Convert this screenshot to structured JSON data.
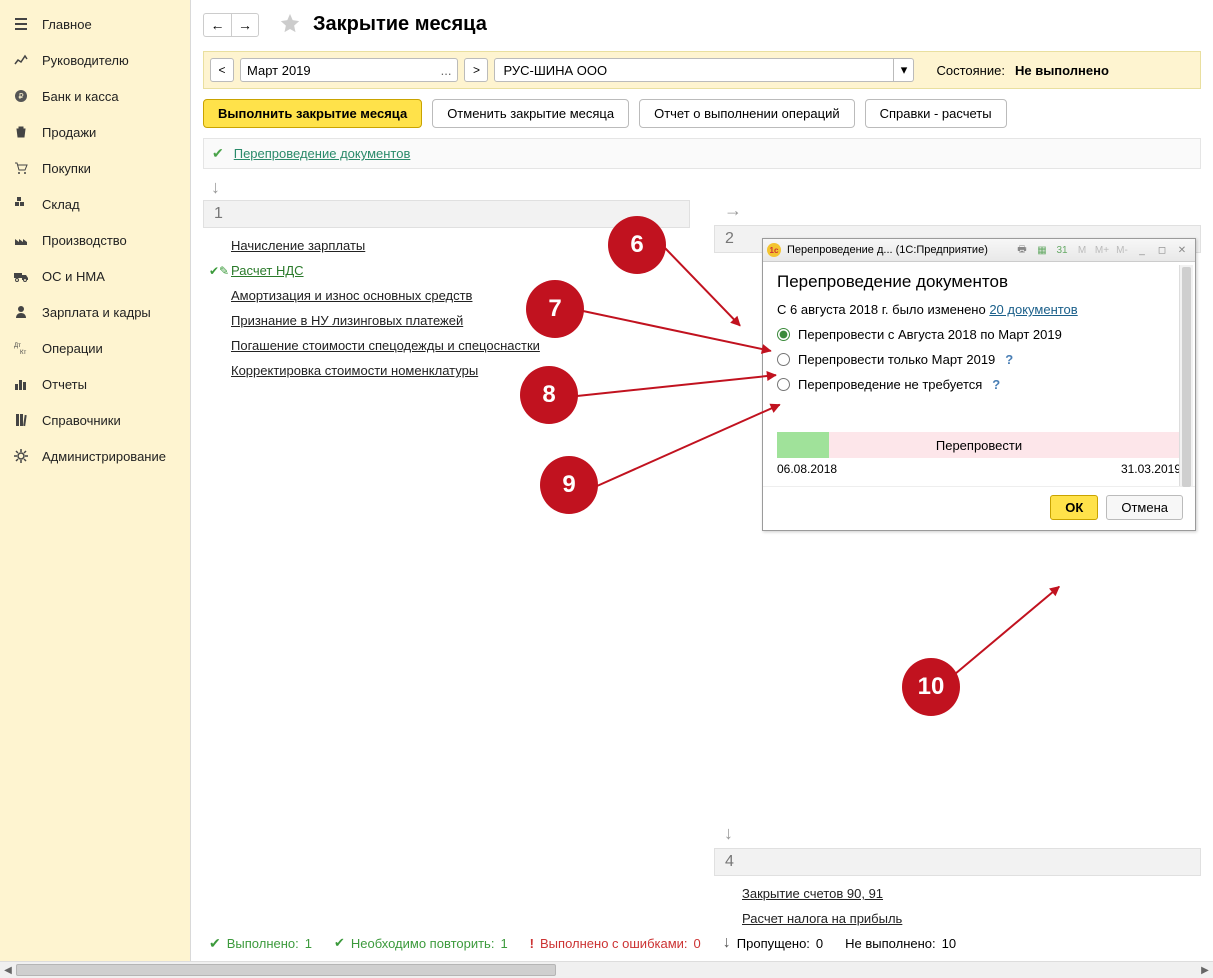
{
  "sidebar": {
    "items": [
      {
        "label": "Главное",
        "icon": "hamburger-icon"
      },
      {
        "label": "Руководителю",
        "icon": "chart-icon"
      },
      {
        "label": "Банк и касса",
        "icon": "ruble-icon"
      },
      {
        "label": "Продажи",
        "icon": "bag-icon"
      },
      {
        "label": "Покупки",
        "icon": "cart-icon"
      },
      {
        "label": "Склад",
        "icon": "warehouse-icon"
      },
      {
        "label": "Производство",
        "icon": "factory-icon"
      },
      {
        "label": "ОС и НМА",
        "icon": "truck-icon"
      },
      {
        "label": "Зарплата и кадры",
        "icon": "person-icon"
      },
      {
        "label": "Операции",
        "icon": "dtkt-icon"
      },
      {
        "label": "Отчеты",
        "icon": "bars-icon"
      },
      {
        "label": "Справочники",
        "icon": "books-icon"
      },
      {
        "label": "Администрирование",
        "icon": "gear-icon"
      }
    ]
  },
  "header": {
    "title": "Закрытие месяца"
  },
  "period": {
    "value": "Март 2019",
    "organization": "РУС-ШИНА ООО",
    "state_label": "Состояние:",
    "state_value": "Не выполнено"
  },
  "actions": {
    "run": "Выполнить закрытие месяца",
    "cancel": "Отменить закрытие месяца",
    "report": "Отчет о выполнении операций",
    "refs": "Справки - расчеты"
  },
  "reproc_link": "Перепроведение документов",
  "col1": {
    "num": "1",
    "items": [
      {
        "label": "Начисление зарплаты",
        "done": false
      },
      {
        "label": "Расчет НДС",
        "done": true
      },
      {
        "label": "Амортизация и износ основных средств",
        "done": false
      },
      {
        "label": "Признание в НУ лизинговых платежей",
        "done": false
      },
      {
        "label": "Погашение стоимости спецодежды и спецоснастки",
        "done": false
      },
      {
        "label": "Корректировка стоимости номенклатуры",
        "done": false
      }
    ]
  },
  "col2": {
    "num": "2"
  },
  "col4": {
    "num": "4",
    "items": [
      {
        "label": "Закрытие счетов 90, 91"
      },
      {
        "label": "Расчет налога на прибыль"
      }
    ]
  },
  "dialog": {
    "titlebar": "Перепроведение д... (1С:Предприятие)",
    "heading": "Перепроведение документов",
    "info_prefix": "С 6 августа 2018 г. было изменено ",
    "info_link": "20 документов",
    "radio1": "Перепровести с Августа 2018 по Март 2019",
    "radio2": "Перепровести только Март 2019",
    "radio3": "Перепроведение не требуется",
    "help": "?",
    "progress_label": "Перепровести",
    "date_from": "06.08.2018",
    "date_to": "31.03.2019",
    "ok": "ОК",
    "cancel": "Отмена"
  },
  "footer": {
    "done_label": "Выполнено:",
    "done_n": "1",
    "repeat_label": "Необходимо повторить:",
    "repeat_n": "1",
    "errors_label": "Выполнено с ошибками:",
    "errors_n": "0",
    "skipped_label": "Пропущено:",
    "skipped_n": "0",
    "notdone_label": "Не выполнено:",
    "notdone_n": "10"
  },
  "annotations": {
    "n6": "6",
    "n7": "7",
    "n8": "8",
    "n9": "9",
    "n10": "10"
  }
}
